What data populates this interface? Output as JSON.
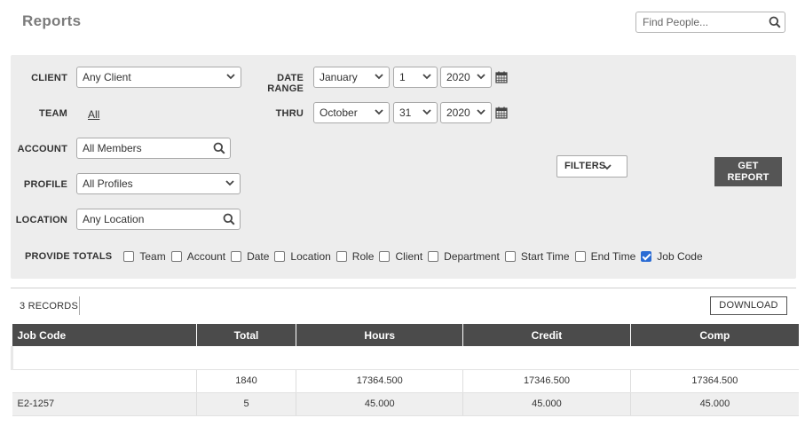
{
  "header": {
    "title": "Reports",
    "search_placeholder": "Find People..."
  },
  "filters": {
    "client_label": "CLIENT",
    "client_value": "Any Client",
    "team_label": "TEAM",
    "team_value": "All",
    "account_label": "ACCOUNT",
    "account_value": "All Members",
    "profile_label": "PROFILE",
    "profile_value": "All Profiles",
    "location_label": "LOCATION",
    "location_value": "Any Location",
    "date_range_label": "DATE RANGE",
    "start_month": "January",
    "start_day": "1",
    "start_year": "2020",
    "thru_label": "THRU",
    "end_month": "October",
    "end_day": "31",
    "end_year": "2020",
    "filters_button": "FILTERS",
    "get_report_line1": "GET",
    "get_report_line2": "REPORT",
    "provide_totals_label": "PROVIDE TOTALS",
    "totals_options": [
      {
        "label": "Team",
        "checked": false
      },
      {
        "label": "Account",
        "checked": false
      },
      {
        "label": "Date",
        "checked": false
      },
      {
        "label": "Location",
        "checked": false
      },
      {
        "label": "Role",
        "checked": false
      },
      {
        "label": "Client",
        "checked": false
      },
      {
        "label": "Department",
        "checked": false
      },
      {
        "label": "Start Time",
        "checked": false
      },
      {
        "label": "End Time",
        "checked": false
      },
      {
        "label": "Job Code",
        "checked": true
      }
    ]
  },
  "results": {
    "records_count": "3 RECORDS",
    "download_label": "DOWNLOAD",
    "columns": [
      "Job Code",
      "Total",
      "Hours",
      "Credit",
      "Comp"
    ],
    "rows": [
      [
        "",
        "1840",
        "17364.500",
        "17346.500",
        "17364.500"
      ],
      [
        "E2-1257",
        "5",
        "45.000",
        "45.000",
        "45.000"
      ]
    ]
  },
  "colors": {
    "header_bg": "#4b4b4b",
    "button_bg": "#555555",
    "panel_bg": "#ededed",
    "checkbox_checked": "#2b6cd4"
  },
  "icons": [
    "search-icon",
    "chevron-down-icon",
    "calendar-icon"
  ]
}
